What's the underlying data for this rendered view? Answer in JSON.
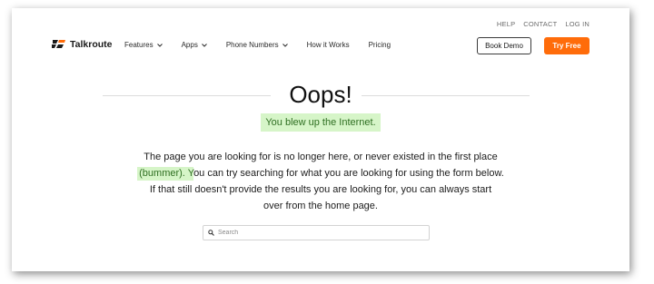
{
  "utility_nav": {
    "help": "HELP",
    "contact": "CONTACT",
    "login": "LOG IN"
  },
  "brand": {
    "name": "Talkroute",
    "icon": "talkroute-logo-mark"
  },
  "nav": {
    "features": "Features",
    "apps": "Apps",
    "phone_numbers": "Phone Numbers",
    "how_it_works": "How it Works",
    "pricing": "Pricing"
  },
  "cta": {
    "book_demo": "Book Demo",
    "try_free": "Try Free"
  },
  "error": {
    "title": "Oops!",
    "subtitle": "You blew up the Internet.",
    "line1": "The page you are looking for is no longer here, or never existed in the first place",
    "line2_highlight": "(bummer). Y",
    "line2_rest": "ou can try searching for what you are looking for using the form below.",
    "line3": "If that still doesn't provide the results you are looking for, you can always start",
    "line4": "over from the home page."
  },
  "search": {
    "placeholder": "Search"
  },
  "colors": {
    "accent_orange": "#ff6c0a",
    "highlight_bg": "#d6f5c8",
    "highlight_text": "#2f6f22"
  }
}
